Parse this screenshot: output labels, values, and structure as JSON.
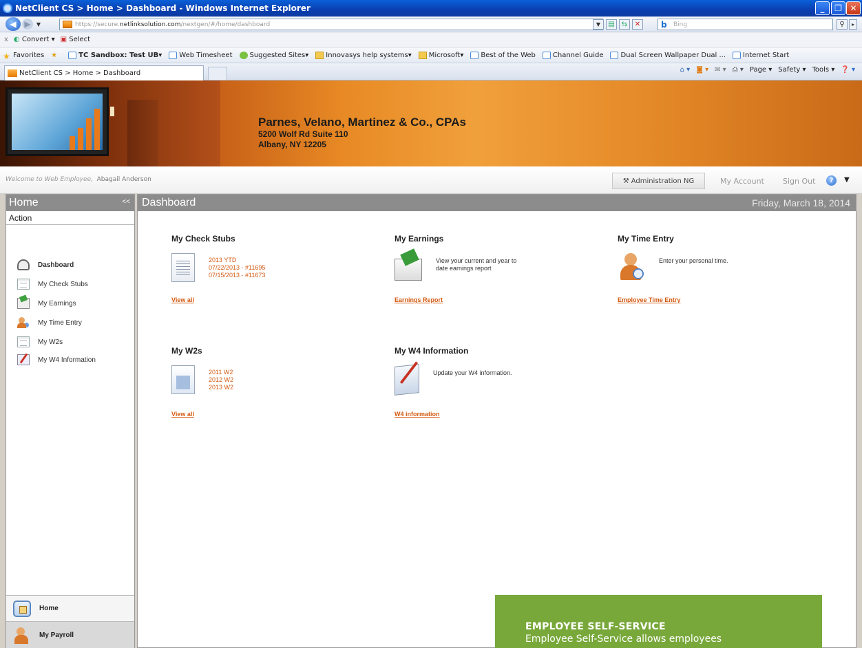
{
  "browser": {
    "window_title": "NetClient CS > Home > Dashboard - Windows Internet Explorer",
    "url_prefix": "https://secure.",
    "url_host": "netlinksolution.com",
    "url_path": "/nextgen/#/home/dashboard",
    "search_placeholder": "Bing",
    "command_bar": [
      "Convert",
      "Select"
    ],
    "favorites_label": "Favorites",
    "favorites": [
      "TC Sandbox: Test UB",
      "Web Timesheet",
      "Suggested Sites",
      "Innovasys help systems",
      "Microsoft",
      "Best of the Web",
      "Channel Guide",
      "Dual Screen Wallpaper Dual ...",
      "Internet Start"
    ],
    "tab_title": "NetClient CS > Home > Dashboard",
    "tab_tools": [
      "Page",
      "Safety",
      "Tools"
    ]
  },
  "banner": {
    "firm_name": "Parnes, Velano, Martinez & Co., CPAs",
    "address_line1": "5200 Wolf Rd Suite 110",
    "address_line2": "Albany, NY 12205"
  },
  "header": {
    "welcome_prefix": "Welcome to Web Employee,",
    "user_name": "Abagail Anderson",
    "admin_button": "Administration NG",
    "my_account": "My Account",
    "sign_out": "Sign Out"
  },
  "sidebar": {
    "title": "Home",
    "collapse": "<<",
    "section": "Action",
    "items": [
      {
        "label": "Dashboard",
        "icon": "dashboard-icon"
      },
      {
        "label": "My Check Stubs",
        "icon": "document-icon"
      },
      {
        "label": "My Earnings",
        "icon": "earnings-envelope-icon"
      },
      {
        "label": "My Time Entry",
        "icon": "person-clock-icon"
      },
      {
        "label": "My W2s",
        "icon": "document-icon"
      },
      {
        "label": "My W4 Information",
        "icon": "pen-form-icon"
      }
    ],
    "bottom_home": "Home",
    "bottom_payroll": "My Payroll"
  },
  "main": {
    "title": "Dashboard",
    "date": "Friday, March 18, 2014",
    "widgets": {
      "check_stubs": {
        "title": "My Check Stubs",
        "links": [
          "2013 YTD",
          "07/22/2013 - #11695",
          "07/15/2013 - #11673"
        ],
        "footer": "View all"
      },
      "earnings": {
        "title": "My Earnings",
        "desc1": "View your current and year to",
        "desc2": "date earnings report",
        "footer": "Earnings Report"
      },
      "time_entry": {
        "title": "My Time Entry",
        "desc": "Enter your personal time.",
        "footer": "Employee Time Entry"
      },
      "w2s": {
        "title": "My W2s",
        "links": [
          "2011 W2",
          "2012 W2",
          "2013 W2"
        ],
        "footer": "View all"
      },
      "w4": {
        "title": "My W4 Information",
        "desc": "Update your W4 information.",
        "footer": "W4 information"
      }
    }
  },
  "callout": {
    "title": "EMPLOYEE SELF-SERVICE",
    "text": "Employee Self-Service allows employees"
  }
}
